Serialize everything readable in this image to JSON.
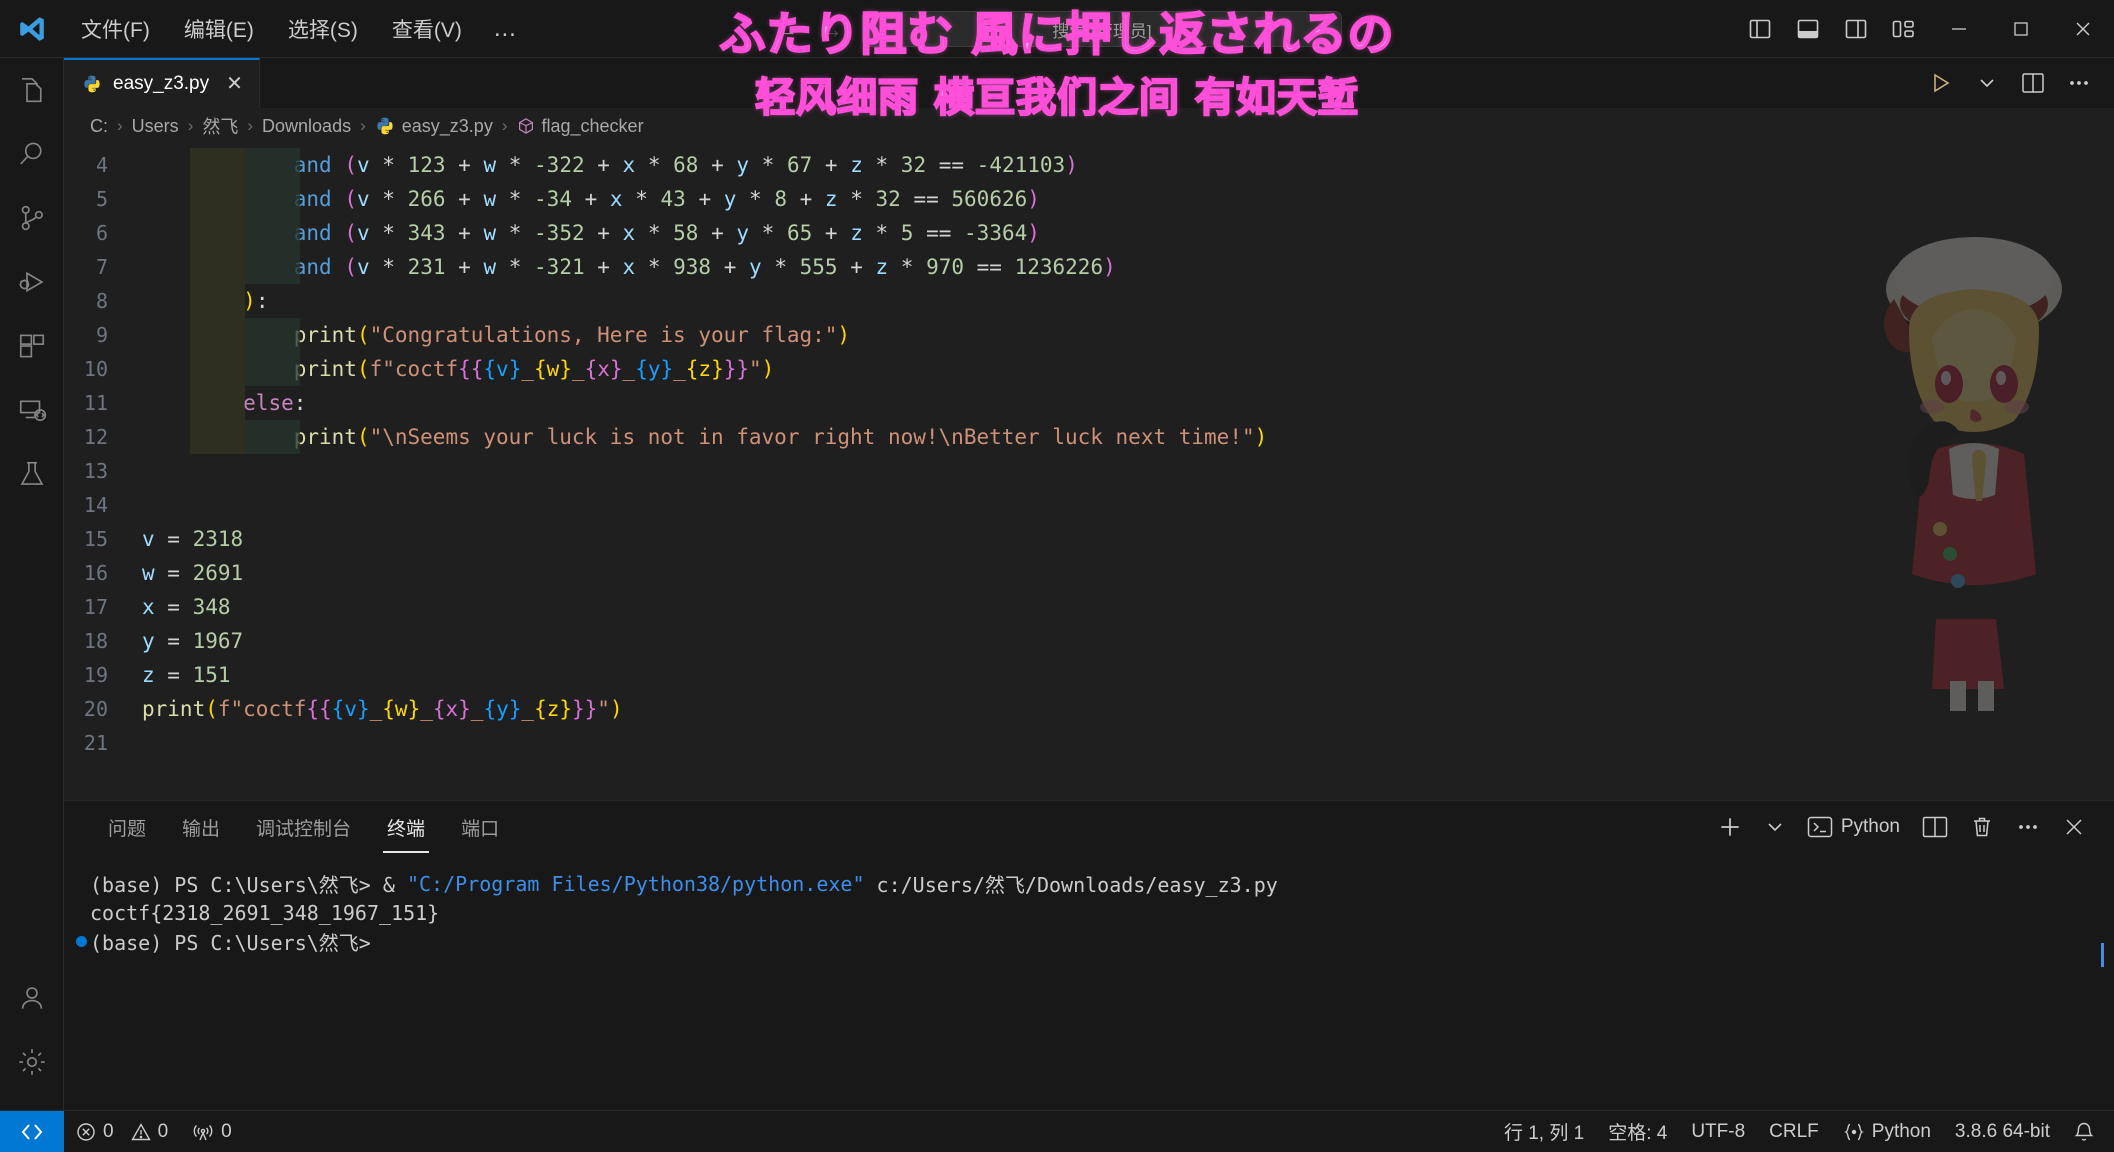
{
  "titlebar": {
    "logo": "vscode-logo",
    "menus": [
      "文件(F)",
      "编辑(E)",
      "选择(S)",
      "查看(V)"
    ],
    "more": "…",
    "back_arrow": "←",
    "forward_arrow": "→",
    "search_placeholder": "搜索 [管理员]",
    "layout_buttons": [
      "toggle-primary-sidebar",
      "toggle-panel",
      "toggle-secondary-sidebar",
      "customize-layout"
    ],
    "window_buttons": {
      "minimize": "—",
      "maximize": "□",
      "close": "✕"
    }
  },
  "subtitle": {
    "line1": "ふたり阻む 風に押し返されるの",
    "line2": "轻风细雨 横亘我们之间 有如天堑",
    "color": "#f3aee8",
    "stroke": "#ff4fd8"
  },
  "activitybar": {
    "items": [
      {
        "name": "explorer",
        "icon": "files-icon"
      },
      {
        "name": "search",
        "icon": "search-icon"
      },
      {
        "name": "source-control",
        "icon": "source-control-icon"
      },
      {
        "name": "run-and-debug",
        "icon": "run-debug-icon"
      },
      {
        "name": "extensions",
        "icon": "extensions-icon"
      },
      {
        "name": "remote-explorer",
        "icon": "remote-explorer-icon"
      },
      {
        "name": "testing",
        "icon": "beaker-icon"
      }
    ],
    "bottom": [
      {
        "name": "accounts",
        "icon": "account-icon"
      },
      {
        "name": "manage",
        "icon": "gear-icon"
      }
    ]
  },
  "tabs": {
    "active_tab": "easy_z3.py",
    "close_glyph": "✕",
    "actions": [
      "run-python-file",
      "run-dropdown",
      "split-editor-right",
      "more-actions"
    ]
  },
  "breadcrumb": {
    "items": [
      "C:",
      "Users",
      "然飞",
      "Downloads",
      "easy_z3.py",
      "flag_checker"
    ],
    "separator": "›"
  },
  "code": {
    "first_line_number": 4,
    "lines": [
      {
        "n": 4,
        "tokens": [
          {
            "t": "            ",
            "c": "op"
          },
          {
            "t": "and",
            "c": "k"
          },
          {
            "t": " ",
            "c": "op"
          },
          {
            "t": "(",
            "c": "p2"
          },
          {
            "t": "v",
            "c": "var"
          },
          {
            "t": " * ",
            "c": "op"
          },
          {
            "t": "123",
            "c": "num"
          },
          {
            "t": " + ",
            "c": "op"
          },
          {
            "t": "w",
            "c": "var"
          },
          {
            "t": " * ",
            "c": "op"
          },
          {
            "t": "-322",
            "c": "num"
          },
          {
            "t": " + ",
            "c": "op"
          },
          {
            "t": "x",
            "c": "var"
          },
          {
            "t": " * ",
            "c": "op"
          },
          {
            "t": "68",
            "c": "num"
          },
          {
            "t": " + ",
            "c": "op"
          },
          {
            "t": "y",
            "c": "var"
          },
          {
            "t": " * ",
            "c": "op"
          },
          {
            "t": "67",
            "c": "num"
          },
          {
            "t": " + ",
            "c": "op"
          },
          {
            "t": "z",
            "c": "var"
          },
          {
            "t": " * ",
            "c": "op"
          },
          {
            "t": "32",
            "c": "num"
          },
          {
            "t": " == ",
            "c": "op"
          },
          {
            "t": "-421103",
            "c": "num"
          },
          {
            "t": ")",
            "c": "p2"
          }
        ],
        "guides": 2
      },
      {
        "n": 5,
        "tokens": [
          {
            "t": "            ",
            "c": "op"
          },
          {
            "t": "and",
            "c": "k"
          },
          {
            "t": " ",
            "c": "op"
          },
          {
            "t": "(",
            "c": "p2"
          },
          {
            "t": "v",
            "c": "var"
          },
          {
            "t": " * ",
            "c": "op"
          },
          {
            "t": "266",
            "c": "num"
          },
          {
            "t": " + ",
            "c": "op"
          },
          {
            "t": "w",
            "c": "var"
          },
          {
            "t": " * ",
            "c": "op"
          },
          {
            "t": "-34",
            "c": "num"
          },
          {
            "t": " + ",
            "c": "op"
          },
          {
            "t": "x",
            "c": "var"
          },
          {
            "t": " * ",
            "c": "op"
          },
          {
            "t": "43",
            "c": "num"
          },
          {
            "t": " + ",
            "c": "op"
          },
          {
            "t": "y",
            "c": "var"
          },
          {
            "t": " * ",
            "c": "op"
          },
          {
            "t": "8",
            "c": "num"
          },
          {
            "t": " + ",
            "c": "op"
          },
          {
            "t": "z",
            "c": "var"
          },
          {
            "t": " * ",
            "c": "op"
          },
          {
            "t": "32",
            "c": "num"
          },
          {
            "t": " == ",
            "c": "op"
          },
          {
            "t": "560626",
            "c": "num"
          },
          {
            "t": ")",
            "c": "p2"
          }
        ],
        "guides": 2
      },
      {
        "n": 6,
        "tokens": [
          {
            "t": "            ",
            "c": "op"
          },
          {
            "t": "and",
            "c": "k"
          },
          {
            "t": " ",
            "c": "op"
          },
          {
            "t": "(",
            "c": "p2"
          },
          {
            "t": "v",
            "c": "var"
          },
          {
            "t": " * ",
            "c": "op"
          },
          {
            "t": "343",
            "c": "num"
          },
          {
            "t": " + ",
            "c": "op"
          },
          {
            "t": "w",
            "c": "var"
          },
          {
            "t": " * ",
            "c": "op"
          },
          {
            "t": "-352",
            "c": "num"
          },
          {
            "t": " + ",
            "c": "op"
          },
          {
            "t": "x",
            "c": "var"
          },
          {
            "t": " * ",
            "c": "op"
          },
          {
            "t": "58",
            "c": "num"
          },
          {
            "t": " + ",
            "c": "op"
          },
          {
            "t": "y",
            "c": "var"
          },
          {
            "t": " * ",
            "c": "op"
          },
          {
            "t": "65",
            "c": "num"
          },
          {
            "t": " + ",
            "c": "op"
          },
          {
            "t": "z",
            "c": "var"
          },
          {
            "t": " * ",
            "c": "op"
          },
          {
            "t": "5",
            "c": "num"
          },
          {
            "t": " == ",
            "c": "op"
          },
          {
            "t": "-3364",
            "c": "num"
          },
          {
            "t": ")",
            "c": "p2"
          }
        ],
        "guides": 2
      },
      {
        "n": 7,
        "tokens": [
          {
            "t": "            ",
            "c": "op"
          },
          {
            "t": "and",
            "c": "k"
          },
          {
            "t": " ",
            "c": "op"
          },
          {
            "t": "(",
            "c": "p2"
          },
          {
            "t": "v",
            "c": "var"
          },
          {
            "t": " * ",
            "c": "op"
          },
          {
            "t": "231",
            "c": "num"
          },
          {
            "t": " + ",
            "c": "op"
          },
          {
            "t": "w",
            "c": "var"
          },
          {
            "t": " * ",
            "c": "op"
          },
          {
            "t": "-321",
            "c": "num"
          },
          {
            "t": " + ",
            "c": "op"
          },
          {
            "t": "x",
            "c": "var"
          },
          {
            "t": " * ",
            "c": "op"
          },
          {
            "t": "938",
            "c": "num"
          },
          {
            "t": " + ",
            "c": "op"
          },
          {
            "t": "y",
            "c": "var"
          },
          {
            "t": " * ",
            "c": "op"
          },
          {
            "t": "555",
            "c": "num"
          },
          {
            "t": " + ",
            "c": "op"
          },
          {
            "t": "z",
            "c": "var"
          },
          {
            "t": " * ",
            "c": "op"
          },
          {
            "t": "970",
            "c": "num"
          },
          {
            "t": " == ",
            "c": "op"
          },
          {
            "t": "1236226",
            "c": "num"
          },
          {
            "t": ")",
            "c": "p2"
          }
        ],
        "guides": 2
      },
      {
        "n": 8,
        "tokens": [
          {
            "t": "        ",
            "c": "op"
          },
          {
            "t": ")",
            "c": "p1"
          },
          {
            "t": ":",
            "c": "op"
          }
        ],
        "guides": 1
      },
      {
        "n": 9,
        "tokens": [
          {
            "t": "            ",
            "c": "op"
          },
          {
            "t": "print",
            "c": "fn"
          },
          {
            "t": "(",
            "c": "p1"
          },
          {
            "t": "\"Congratulations, Here is your flag:\"",
            "c": "str"
          },
          {
            "t": ")",
            "c": "p1"
          }
        ],
        "guides": 2
      },
      {
        "n": 10,
        "tokens": [
          {
            "t": "            ",
            "c": "op"
          },
          {
            "t": "print",
            "c": "fn"
          },
          {
            "t": "(",
            "c": "p1"
          },
          {
            "t": "f\"coctf",
            "c": "str"
          },
          {
            "t": "{{",
            "c": "p2"
          },
          {
            "t": "{v}",
            "c": "p3"
          },
          {
            "t": "_",
            "c": "str"
          },
          {
            "t": "{w}",
            "c": "p1"
          },
          {
            "t": "_",
            "c": "str"
          },
          {
            "t": "{x}",
            "c": "p2"
          },
          {
            "t": "_",
            "c": "str"
          },
          {
            "t": "{y}",
            "c": "p3"
          },
          {
            "t": "_",
            "c": "str"
          },
          {
            "t": "{z}",
            "c": "p1"
          },
          {
            "t": "}}",
            "c": "p2"
          },
          {
            "t": "\"",
            "c": "str"
          },
          {
            "t": ")",
            "c": "p1"
          }
        ],
        "guides": 2
      },
      {
        "n": 11,
        "tokens": [
          {
            "t": "        ",
            "c": "op"
          },
          {
            "t": "else",
            "c": "kw"
          },
          {
            "t": ":",
            "c": "op"
          }
        ],
        "guides": 1
      },
      {
        "n": 12,
        "tokens": [
          {
            "t": "            ",
            "c": "op"
          },
          {
            "t": "print",
            "c": "fn"
          },
          {
            "t": "(",
            "c": "p1"
          },
          {
            "t": "\"\\nSeems your luck is not in favor right now!\\nBetter luck next time!\"",
            "c": "str"
          },
          {
            "t": ")",
            "c": "p1"
          }
        ],
        "guides": 2
      },
      {
        "n": 13,
        "tokens": [],
        "guides": 0
      },
      {
        "n": 14,
        "tokens": [],
        "guides": 0
      },
      {
        "n": 15,
        "tokens": [
          {
            "t": "v",
            "c": "var"
          },
          {
            "t": " = ",
            "c": "op"
          },
          {
            "t": "2318",
            "c": "num"
          }
        ],
        "guides": 0
      },
      {
        "n": 16,
        "tokens": [
          {
            "t": "w",
            "c": "var"
          },
          {
            "t": " = ",
            "c": "op"
          },
          {
            "t": "2691",
            "c": "num"
          }
        ],
        "guides": 0
      },
      {
        "n": 17,
        "tokens": [
          {
            "t": "x",
            "c": "var"
          },
          {
            "t": " = ",
            "c": "op"
          },
          {
            "t": "348",
            "c": "num"
          }
        ],
        "guides": 0
      },
      {
        "n": 18,
        "tokens": [
          {
            "t": "y",
            "c": "var"
          },
          {
            "t": " = ",
            "c": "op"
          },
          {
            "t": "1967",
            "c": "num"
          }
        ],
        "guides": 0
      },
      {
        "n": 19,
        "tokens": [
          {
            "t": "z",
            "c": "var"
          },
          {
            "t": " = ",
            "c": "op"
          },
          {
            "t": "151",
            "c": "num"
          }
        ],
        "guides": 0
      },
      {
        "n": 20,
        "tokens": [
          {
            "t": "print",
            "c": "fn"
          },
          {
            "t": "(",
            "c": "p1"
          },
          {
            "t": "f\"coctf",
            "c": "str"
          },
          {
            "t": "{{",
            "c": "p2"
          },
          {
            "t": "{v}",
            "c": "p3"
          },
          {
            "t": "_",
            "c": "str"
          },
          {
            "t": "{w}",
            "c": "p1"
          },
          {
            "t": "_",
            "c": "str"
          },
          {
            "t": "{x}",
            "c": "p2"
          },
          {
            "t": "_",
            "c": "str"
          },
          {
            "t": "{y}",
            "c": "p3"
          },
          {
            "t": "_",
            "c": "str"
          },
          {
            "t": "{z}",
            "c": "p1"
          },
          {
            "t": "}}",
            "c": "p2"
          },
          {
            "t": "\"",
            "c": "str"
          },
          {
            "t": ")",
            "c": "p1"
          }
        ],
        "guides": 0
      },
      {
        "n": 21,
        "tokens": [],
        "guides": 0
      }
    ]
  },
  "panel": {
    "tabs": [
      "问题",
      "输出",
      "调试控制台",
      "终端",
      "端口"
    ],
    "active_tab": "终端",
    "terminal_label": "Python",
    "actions": [
      "new-terminal",
      "new-terminal-dropdown",
      "terminal-python",
      "split-terminal",
      "kill-terminal",
      "more-actions",
      "close-panel"
    ],
    "output": [
      {
        "segments": [
          {
            "t": "(base) PS C:\\Users\\然飞> & ",
            "c": ""
          },
          {
            "t": "\"C:/Program Files/Python38/python.exe\"",
            "c": "t-blue"
          },
          {
            "t": " c:/Users/然飞/Downloads/easy_z3.py",
            "c": ""
          }
        ],
        "prompt_dot": false
      },
      {
        "segments": [
          {
            "t": "coctf{2318_2691_348_1967_151}",
            "c": ""
          }
        ],
        "prompt_dot": false
      },
      {
        "segments": [
          {
            "t": "(base) PS C:\\Users\\然飞>",
            "c": ""
          }
        ],
        "prompt_dot": true
      }
    ]
  },
  "statusbar": {
    "remote_icon": "remote-window-icon",
    "errors": "0",
    "warnings": "0",
    "ports": "0",
    "line_col": "行 1, 列 1",
    "indent": "空格: 4",
    "encoding": "UTF-8",
    "eol": "CRLF",
    "language": "Python",
    "interpreter": "3.8.6 64-bit",
    "bell": "bell-icon"
  }
}
